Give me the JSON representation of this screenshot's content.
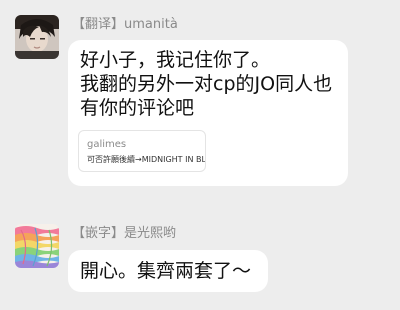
{
  "messages": [
    {
      "sender": "【翻译】umanità",
      "lines": [
        "好小子，我记住你了。",
        "我翻的另外一对cp的JO同人也",
        "有你的评论吧"
      ],
      "link_card": {
        "site": "galimes",
        "title": "可否許願後續→MIDNIGHT IN BL"
      }
    },
    {
      "sender": "【嵌字】是光熙哟",
      "lines": [
        "開心。集齊兩套了～"
      ]
    }
  ],
  "colors": {
    "background": "#ededed",
    "bubble": "#ffffff",
    "sender": "#8a8a8a",
    "text": "#111111",
    "rainbow": [
      "#f27a9a",
      "#f5a35a",
      "#f3d768",
      "#8ad37a",
      "#6fb4e6",
      "#9a86d8"
    ]
  }
}
